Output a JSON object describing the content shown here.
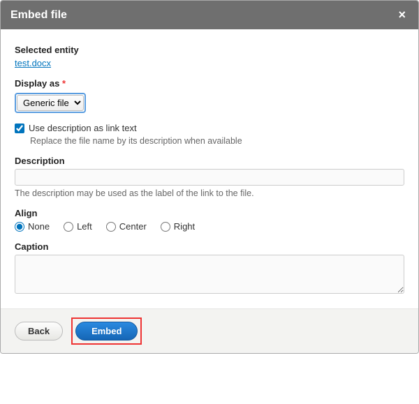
{
  "header": {
    "title": "Embed file",
    "close_label": "×"
  },
  "entity": {
    "label": "Selected entity",
    "name": "test.docx"
  },
  "display_as": {
    "label": "Display as",
    "required_marker": "*",
    "selected": "Generic file"
  },
  "use_description": {
    "checked": true,
    "label": "Use description as link text",
    "help": "Replace the file name by its description when available"
  },
  "description": {
    "label": "Description",
    "value": "",
    "help": "The description may be used as the label of the link to the file."
  },
  "align": {
    "label": "Align",
    "options": [
      {
        "value": "none",
        "label": "None"
      },
      {
        "value": "left",
        "label": "Left"
      },
      {
        "value": "center",
        "label": "Center"
      },
      {
        "value": "right",
        "label": "Right"
      }
    ],
    "selected": "none"
  },
  "caption": {
    "label": "Caption",
    "value": ""
  },
  "footer": {
    "back_label": "Back",
    "embed_label": "Embed"
  }
}
